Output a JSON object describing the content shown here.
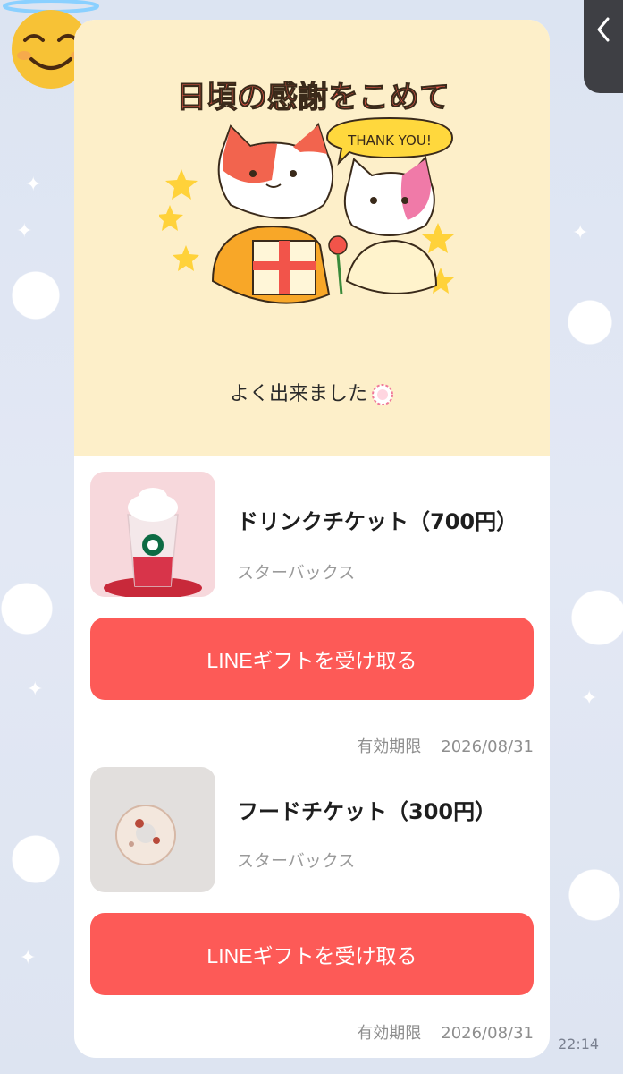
{
  "chat": {
    "time": "22:14"
  },
  "card": {
    "art_heading": "日頃の感謝をこめて",
    "art_bubble": "THANK YOU!",
    "message": "よく出来ました",
    "products": [
      {
        "title": "ドリンクチケット（700円）",
        "brand": "スターバックス",
        "button": "LINEギフトを受け取る",
        "expiry_label": "有効期限",
        "expiry_date": "2026/08/31"
      },
      {
        "title": "フードチケット（300円）",
        "brand": "スターバックス",
        "button": "LINEギフトを受け取る",
        "expiry_label": "有効期限",
        "expiry_date": "2026/08/31"
      }
    ]
  },
  "icons": {
    "avatar": "smiling-face-with-halo-icon",
    "back": "chevron-left-icon",
    "badge": "flower-stamp-icon"
  },
  "colors": {
    "cta": "#fd5a57",
    "header_bg": "#fdefc9",
    "wallpaper": "#dfe6f3"
  }
}
